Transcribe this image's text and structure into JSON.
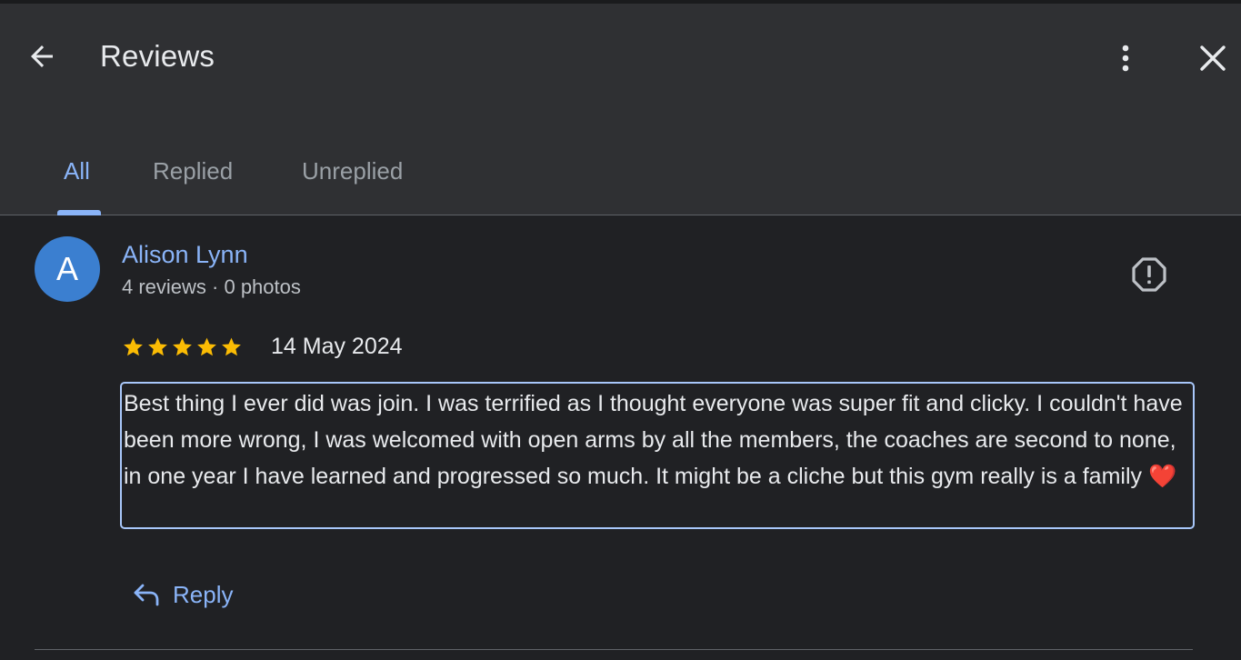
{
  "header": {
    "title": "Reviews",
    "back_icon": "arrow-back-icon",
    "more_icon": "more-vert-icon",
    "close_icon": "close-icon"
  },
  "tabs": [
    {
      "label": "All",
      "active": true
    },
    {
      "label": "Replied",
      "active": false
    },
    {
      "label": "Unreplied",
      "active": false
    }
  ],
  "review": {
    "author": "Alison Lynn",
    "avatar_letter": "A",
    "meta": "4 reviews · 0 photos",
    "rating": 5,
    "rating_max": 5,
    "date": "14 May 2024",
    "text": "Best thing I ever did was join. I was terrified as I thought everyone was super fit and clicky. I couldn't have been more wrong, I was welcomed with open arms by all the members, the coaches are second to none, in one year I have learned and progressed so much. It might be a cliche but this gym really is a family",
    "emoji": "❤️",
    "reply_label": "Reply",
    "report_icon": "report-icon"
  },
  "colors": {
    "background": "#202124",
    "header_bg": "#2f3033",
    "accent": "#8ab4f8",
    "avatar_bg": "#3b7fd0",
    "star": "#fbbc04"
  }
}
